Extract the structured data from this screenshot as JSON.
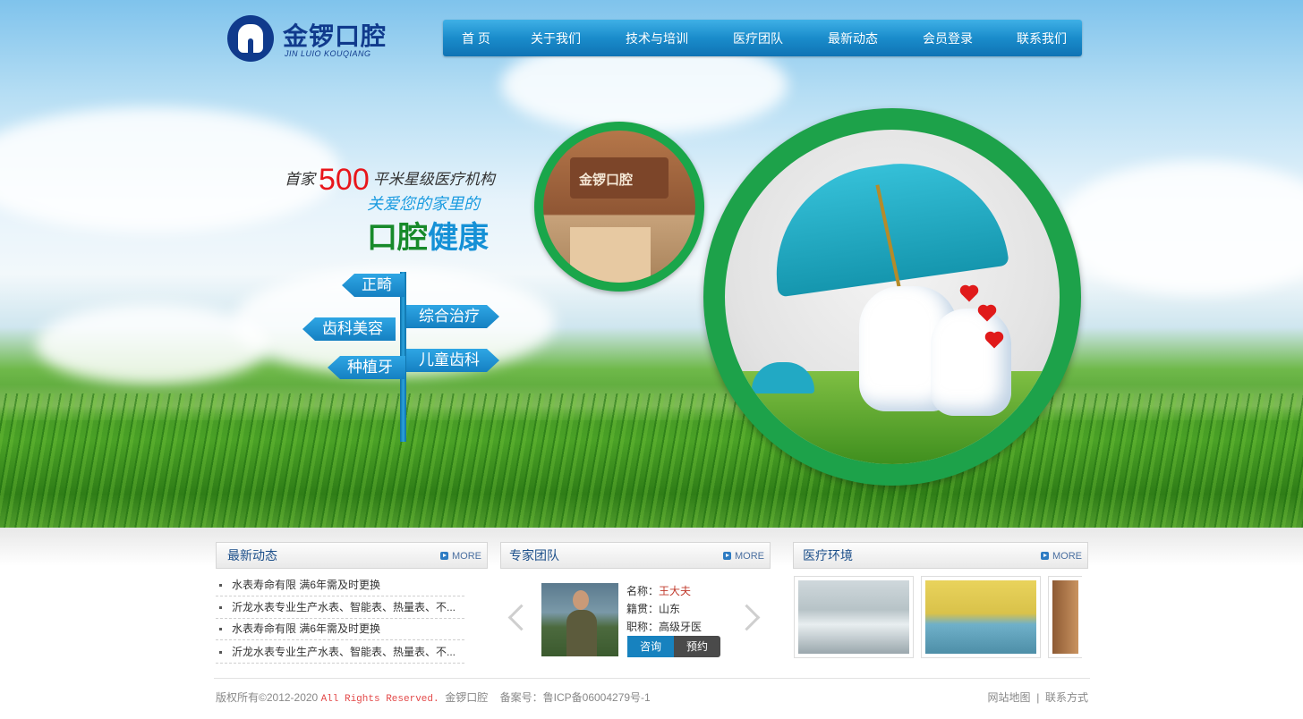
{
  "brand": {
    "name_cn": "金锣口腔",
    "name_en": "JIN LUIO KOUQIANG"
  },
  "nav": {
    "items": [
      "首 页",
      "关于我们",
      "技术与培训",
      "医疗团队",
      "最新动态",
      "会员登录",
      "联系我们"
    ]
  },
  "hero": {
    "slogan_prefix": "首家",
    "slogan_number": "500",
    "slogan_suffix": "平米星级医疗机构",
    "slogan_line2": "关爱您的家里的",
    "slogan_line3_a": "口腔",
    "slogan_line3_b": "健康",
    "signs": [
      "正畸",
      "综合治疗",
      "齿科美容",
      "种植牙",
      "儿童齿科"
    ],
    "clinic_wall_text": "金锣口腔"
  },
  "news": {
    "title": "最新动态",
    "more": "MORE",
    "items": [
      "水表寿命有限 满6年需及时更换",
      "沂龙水表专业生产水表、智能表、热量表、不...",
      "水表寿命有限 满6年需及时更换",
      "沂龙水表专业生产水表、智能表、热量表、不..."
    ]
  },
  "experts": {
    "title": "专家团队",
    "more": "MORE",
    "doctor": {
      "name_label": "名称：",
      "name": "王大夫",
      "origin_label": "籍贯：",
      "origin": "山东",
      "title_label": "职称：",
      "title": "高级牙医"
    },
    "consult_btn": "咨询",
    "book_btn": "预约"
  },
  "environment": {
    "title": "医疗环境",
    "more": "MORE"
  },
  "footer": {
    "copyright": "版权所有©2012-2020",
    "rights": "All Rights Reserved.",
    "company": "金锣口腔",
    "icp": "备案号：鲁ICP备06004279号-1",
    "sitemap": "网站地图",
    "separator": "|",
    "contact": "联系方式"
  },
  "colors": {
    "nav_blue": "#1a8ccb",
    "brand_navy": "#103a8c",
    "ring_green": "#1da24a",
    "accent_red": "#e8161b"
  }
}
